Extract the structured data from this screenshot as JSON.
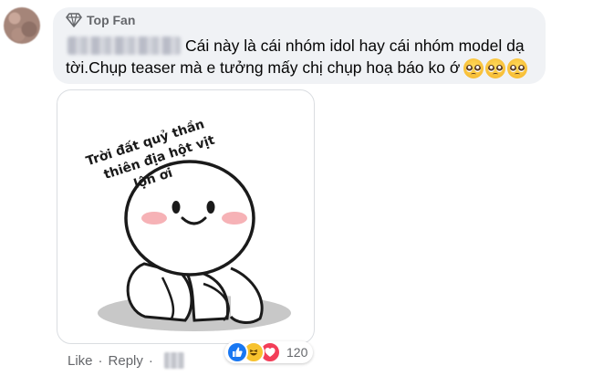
{
  "comment": {
    "badge": "Top Fan",
    "text": "Cái này là cái nhóm idol hay cái nhóm model dạ tời.Chụp teaser mà e tưởng mấy chị chụp hoạ báo ko ớ",
    "emojis": [
      "pleading-face",
      "pleading-face",
      "pleading-face"
    ]
  },
  "sticker": {
    "caption_lines": [
      "Trời đất quỷ thần",
      "thiên địa hột vịt",
      "lộn ơi"
    ]
  },
  "actions": {
    "like": "Like",
    "reply": "Reply",
    "separator": "·"
  },
  "reactions": {
    "icons": [
      "like-icon",
      "haha-icon",
      "love-icon"
    ],
    "count": "120"
  },
  "colors": {
    "bubble": "#f0f2f5",
    "text": "#050505",
    "muted": "#65676b",
    "like_blue": "#1877f2",
    "love_red": "#f33e58",
    "haha_yellow": "#f7c22e"
  }
}
